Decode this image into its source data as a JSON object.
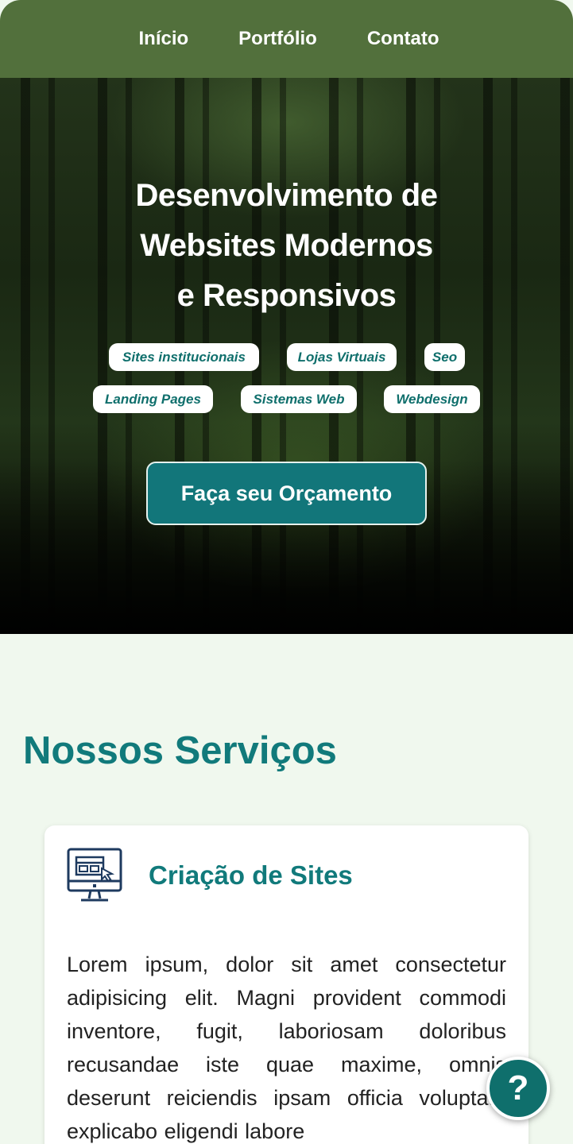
{
  "nav": {
    "items": [
      {
        "label": "Início"
      },
      {
        "label": "Portfólio"
      },
      {
        "label": "Contato"
      }
    ]
  },
  "hero": {
    "title_lines": [
      "Desenvolvimento de",
      "Websites Modernos",
      "e Responsivos"
    ],
    "tags": [
      "Sites institucionais",
      "Lojas Virtuais",
      "Seo",
      "Landing Pages",
      "Sistemas Web",
      "Webdesign"
    ],
    "cta_label": "Faça seu Orçamento"
  },
  "services": {
    "title": "Nossos Serviços",
    "cards": [
      {
        "icon": "website-monitor-icon",
        "title": "Criação de Sites",
        "text": "Lorem ipsum, dolor sit amet consectetur adipisicing elit. Magni provident commodi inventore, fugit, laboriosam doloribus recusandae iste quae maxime, omnis deserunt reiciendis ipsam officia voluptate explicabo eligendi labore"
      }
    ]
  },
  "help_button": {
    "label": "?",
    "icon": "question-mark-icon"
  },
  "colors": {
    "nav_bg": "#52703c",
    "accent": "#117a7b",
    "cta_bg": "#12767a",
    "page_bg": "#f0f8ee"
  }
}
